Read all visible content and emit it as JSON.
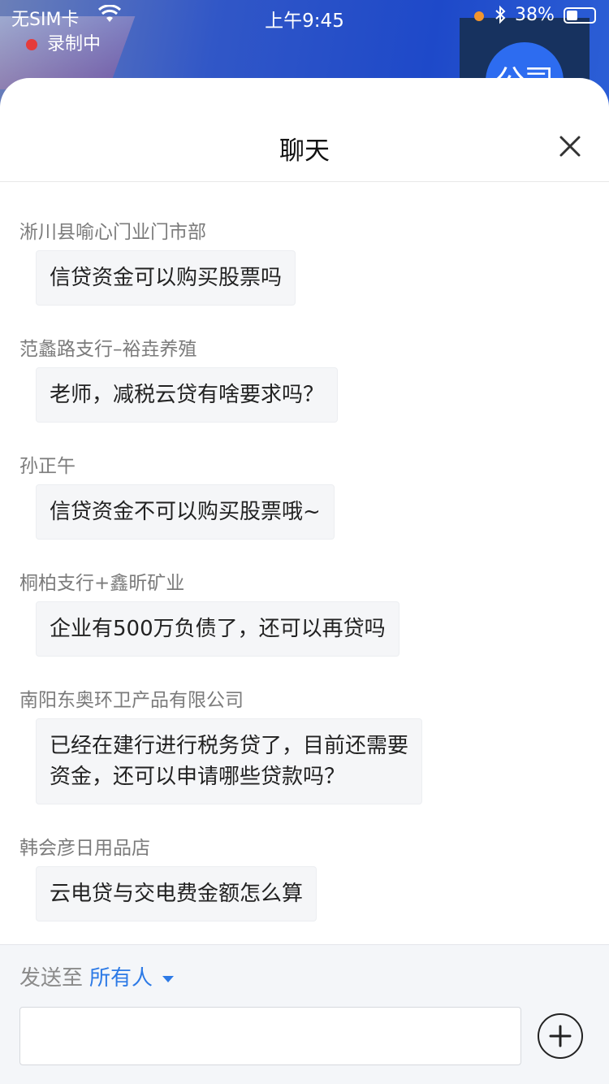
{
  "status_bar": {
    "carrier": "无SIM卡",
    "time": "上午9:45",
    "battery": "38%",
    "recording": "录制中"
  },
  "video": {
    "avatar_text": "公司"
  },
  "sheet": {
    "title": "聊天"
  },
  "messages": [
    {
      "sender": "淅川县喻心门业门市部",
      "text": "信贷资金可以购买股票吗"
    },
    {
      "sender": "范蠡路支行–裕垚养殖",
      "text": "老师，减税云贷有啥要求吗？"
    },
    {
      "sender": "孙正午",
      "text": "信贷资金不可以购买股票哦~"
    },
    {
      "sender": "桐柏支行+鑫昕矿业",
      "text": "企业有500万负债了，还可以再贷吗"
    },
    {
      "sender": "南阳东奥环卫产品有限公司",
      "text_line1": "已经在建行进行税务贷了，目前还需要",
      "text_line2": "资金，还可以申请哪些贷款吗？"
    },
    {
      "sender": "韩会彦日用品店",
      "text": "云电贷与交电费金额怎么算"
    }
  ],
  "composer": {
    "send_to_label": "发送至",
    "send_to_target": "所有人",
    "input_value": ""
  },
  "icons": [
    "wifi-icon",
    "bluetooth-icon",
    "battery-icon",
    "close-icon",
    "caret-down-icon",
    "add-icon"
  ]
}
